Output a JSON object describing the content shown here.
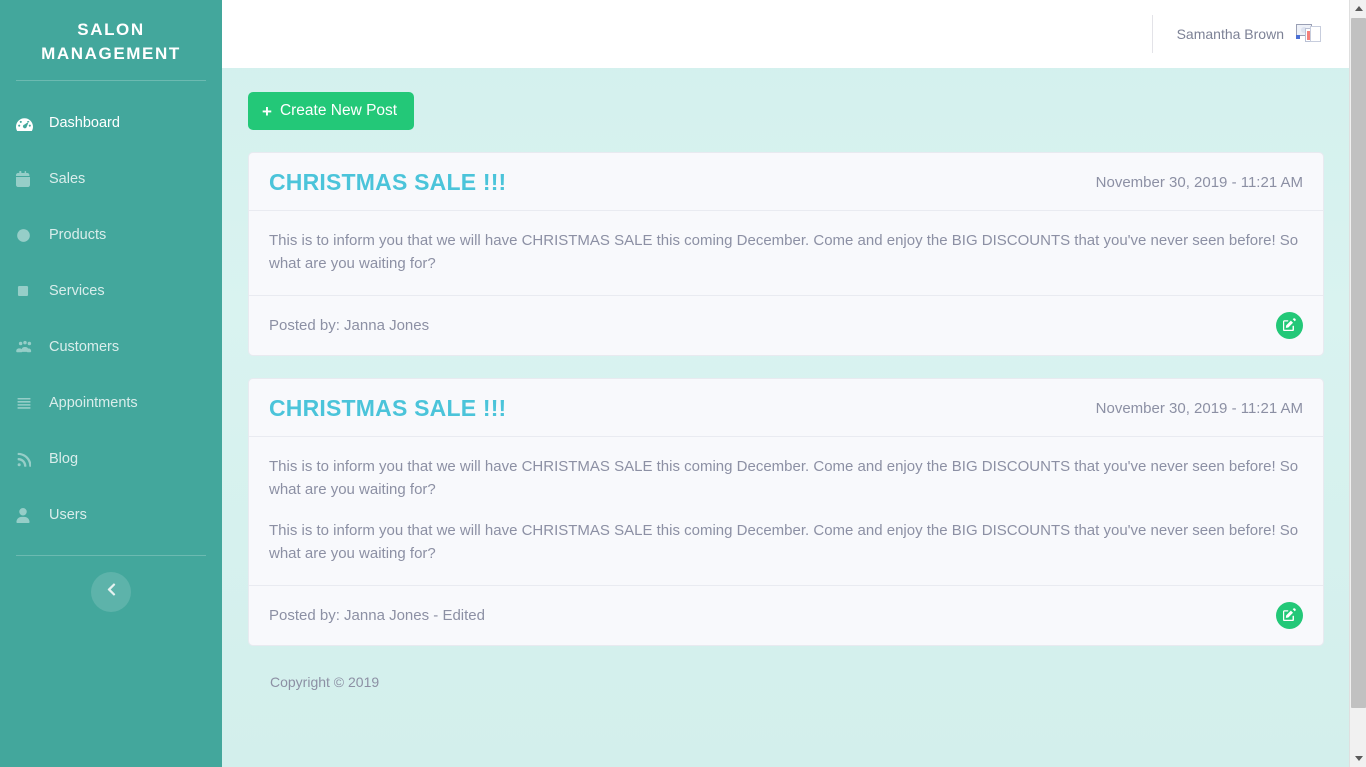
{
  "sidebar": {
    "brand_line1": "SALON",
    "brand_line2": "MANAGEMENT",
    "items": [
      {
        "label": "Dashboard",
        "icon": "tachometer-icon",
        "active": true
      },
      {
        "label": "Sales",
        "icon": "calendar-icon",
        "active": false
      },
      {
        "label": "Products",
        "icon": "circle-icon",
        "active": false
      },
      {
        "label": "Services",
        "icon": "square-icon",
        "active": false
      },
      {
        "label": "Customers",
        "icon": "users-icon",
        "active": false
      },
      {
        "label": "Appointments",
        "icon": "list-icon",
        "active": false
      },
      {
        "label": "Blog",
        "icon": "rss-icon",
        "active": false
      },
      {
        "label": "Users",
        "icon": "user-icon",
        "active": false
      }
    ],
    "collapse_icon": "chevron-left-icon"
  },
  "topbar": {
    "user_name": "Samantha Brown",
    "avatar_icon": "broken-image-icon"
  },
  "toolbar": {
    "create_label": "Create New Post",
    "create_icon": "plus-icon"
  },
  "posts": [
    {
      "title": "CHRISTMAS SALE !!!",
      "date": "November 30, 2019 - 11:21 AM",
      "paragraphs": [
        "This is to inform you that we will have CHRISTMAS SALE this coming December. Come and enjoy the BIG DISCOUNTS that you've never seen before! So what are you waiting for?"
      ],
      "posted_by": "Posted by: Janna Jones",
      "edit_icon": "pen-to-square-icon"
    },
    {
      "title": "CHRISTMAS SALE !!!",
      "date": "November 30, 2019 - 11:21 AM",
      "paragraphs": [
        "This is to inform you that we will have CHRISTMAS SALE this coming December. Come and enjoy the BIG DISCOUNTS that you've never seen before! So what are you waiting for?",
        "This is to inform you that we will have CHRISTMAS SALE this coming December. Come and enjoy the BIG DISCOUNTS that you've never seen before! So what are you waiting for?"
      ],
      "posted_by": "Posted by: Janna Jones - Edited",
      "edit_icon": "pen-to-square-icon"
    }
  ],
  "footer": {
    "copyright": "Copyright © 2019"
  },
  "colors": {
    "sidebar_bg": "#43a79c",
    "content_bg": "#d6f1ee",
    "accent_green": "#23c878",
    "title_cyan": "#4bc4da",
    "muted_text": "#8c90a4"
  },
  "scrollbar": {
    "up_icon": "triangle-up-icon",
    "down_icon": "triangle-down-icon"
  }
}
